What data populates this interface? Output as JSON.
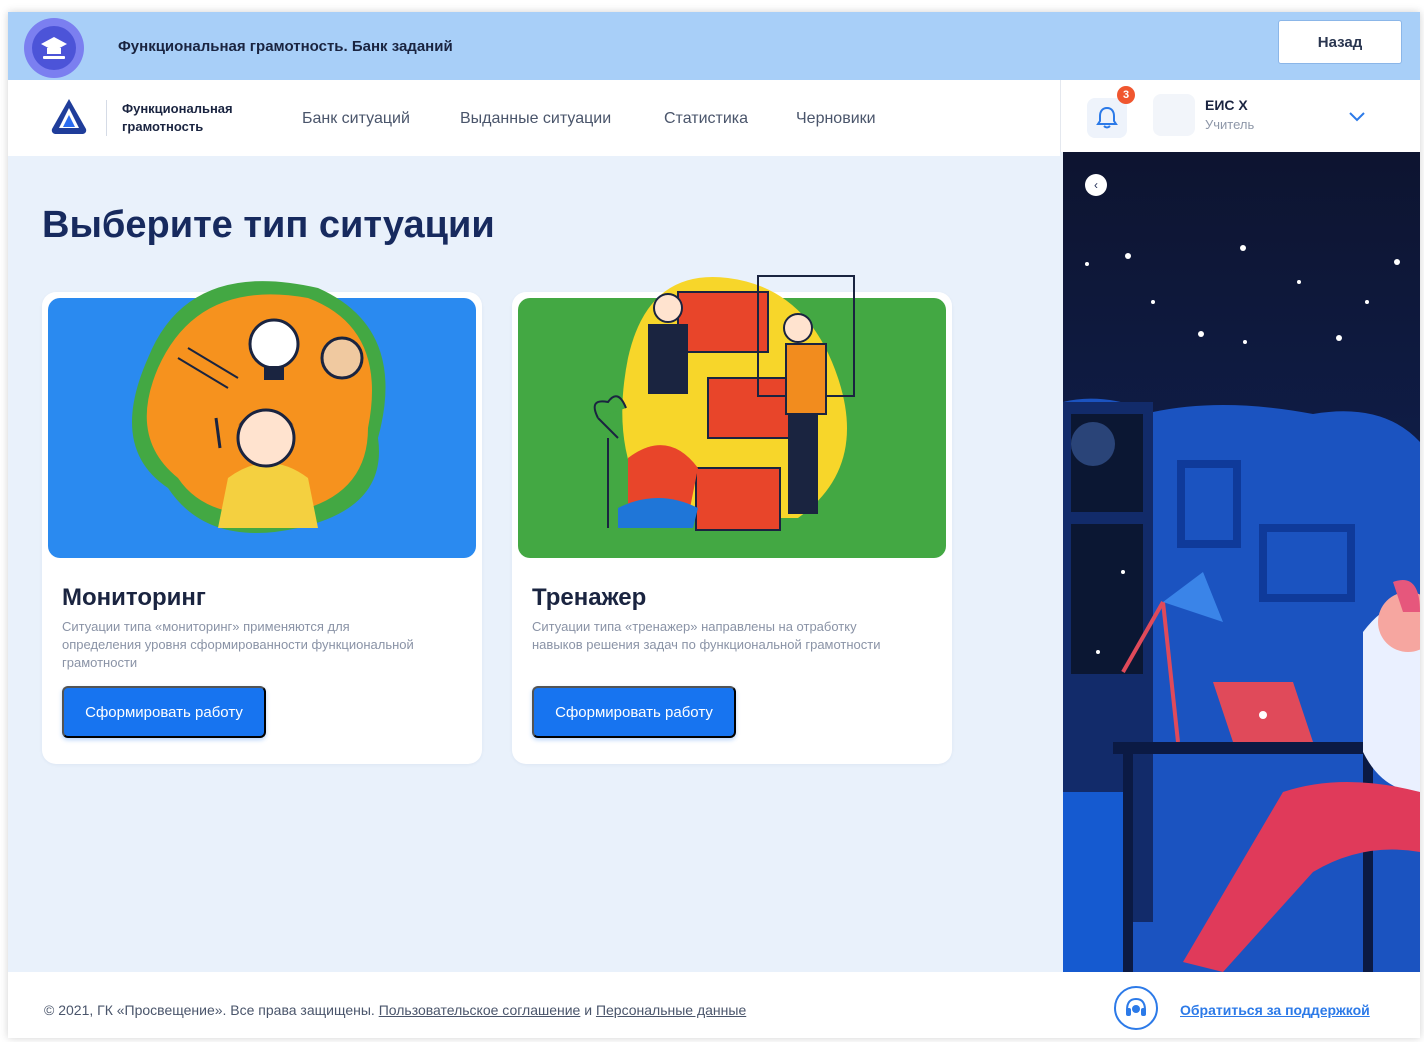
{
  "header": {
    "app_title": "Функциональная грамотность. Банк заданий",
    "back_label": "Назад"
  },
  "nav": {
    "brand_line1": "Функциональная",
    "brand_line2": "грамотность",
    "items": [
      {
        "label": "Банк ситуаций"
      },
      {
        "label": "Выданные ситуации"
      },
      {
        "label": "Статистика"
      },
      {
        "label": "Черновики"
      }
    ]
  },
  "user": {
    "notifications": "3",
    "name": "ЕИС Х",
    "role": "Учитель"
  },
  "main": {
    "title": "Выберите тип ситуации",
    "cards": [
      {
        "title": "Мониторинг",
        "description": "Ситуации типа «мониторинг» применяются для определения уровня сформированности функциональной грамотности",
        "button": "Сформировать работу"
      },
      {
        "title": "Тренажер",
        "description": "Ситуации типа «тренажер» направлены на отработку навыков решения задач по функциональной грамотности",
        "button": "Сформировать работу"
      }
    ]
  },
  "footer": {
    "copyright": "© 2021, ГК «Просвещение». Все права защищены.",
    "agreement_link": "Пользовательское соглашение",
    "and": "и",
    "personal_link": "Персональные данные",
    "support": "Обратиться за поддержкой"
  },
  "colors": {
    "accent": "#1774f0",
    "topbar": "#a8cff8",
    "page_bg": "#e9f1fb",
    "card1_art": "#2a8af0",
    "card2_art": "#43a843"
  }
}
